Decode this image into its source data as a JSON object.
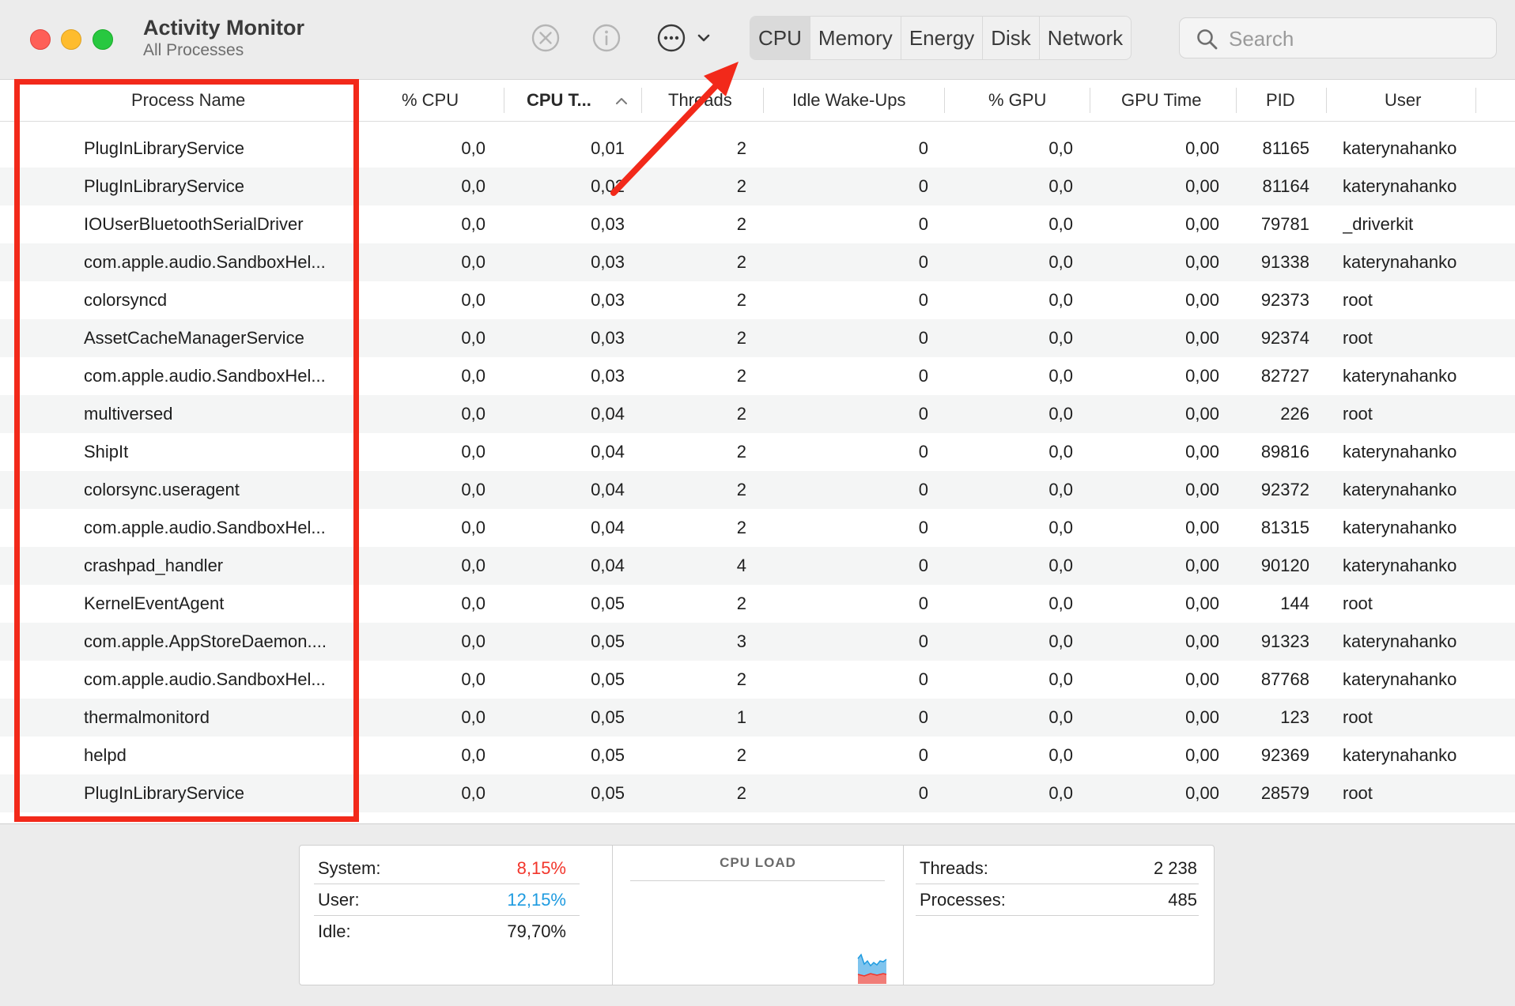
{
  "window": {
    "title": "Activity Monitor",
    "subtitle": "All Processes"
  },
  "toolbar": {
    "icons": [
      "stop-process-icon",
      "info-icon",
      "more-options-icon",
      "chevron-down-icon"
    ],
    "tabs": [
      {
        "label": "CPU",
        "active": true
      },
      {
        "label": "Memory",
        "active": false
      },
      {
        "label": "Energy",
        "active": false
      },
      {
        "label": "Disk",
        "active": false
      },
      {
        "label": "Network",
        "active": false
      }
    ],
    "search": {
      "placeholder": "Search",
      "value": ""
    }
  },
  "table": {
    "columns": [
      {
        "label": "Process Name"
      },
      {
        "label": "% CPU"
      },
      {
        "label": "CPU T...",
        "sorted": true,
        "sort_direction": "ascending"
      },
      {
        "label": "Threads"
      },
      {
        "label": "Idle Wake-Ups"
      },
      {
        "label": "% GPU"
      },
      {
        "label": "GPU Time"
      },
      {
        "label": "PID"
      },
      {
        "label": "User"
      }
    ],
    "rows": [
      [
        "PlugInLibraryService",
        "0,0",
        "0,01",
        "2",
        "0",
        "0,0",
        "0,00",
        "81165",
        "katerynahanko"
      ],
      [
        "PlugInLibraryService",
        "0,0",
        "0,02",
        "2",
        "0",
        "0,0",
        "0,00",
        "81164",
        "katerynahanko"
      ],
      [
        "IOUserBluetoothSerialDriver",
        "0,0",
        "0,03",
        "2",
        "0",
        "0,0",
        "0,00",
        "79781",
        "_driverkit"
      ],
      [
        "com.apple.audio.SandboxHel...",
        "0,0",
        "0,03",
        "2",
        "0",
        "0,0",
        "0,00",
        "91338",
        "katerynahanko"
      ],
      [
        "colorsyncd",
        "0,0",
        "0,03",
        "2",
        "0",
        "0,0",
        "0,00",
        "92373",
        "root"
      ],
      [
        "AssetCacheManagerService",
        "0,0",
        "0,03",
        "2",
        "0",
        "0,0",
        "0,00",
        "92374",
        "root"
      ],
      [
        "com.apple.audio.SandboxHel...",
        "0,0",
        "0,03",
        "2",
        "0",
        "0,0",
        "0,00",
        "82727",
        "katerynahanko"
      ],
      [
        "multiversed",
        "0,0",
        "0,04",
        "2",
        "0",
        "0,0",
        "0,00",
        "226",
        "root"
      ],
      [
        "ShipIt",
        "0,0",
        "0,04",
        "2",
        "0",
        "0,0",
        "0,00",
        "89816",
        "katerynahanko"
      ],
      [
        "colorsync.useragent",
        "0,0",
        "0,04",
        "2",
        "0",
        "0,0",
        "0,00",
        "92372",
        "katerynahanko"
      ],
      [
        "com.apple.audio.SandboxHel...",
        "0,0",
        "0,04",
        "2",
        "0",
        "0,0",
        "0,00",
        "81315",
        "katerynahanko"
      ],
      [
        "crashpad_handler",
        "0,0",
        "0,04",
        "4",
        "0",
        "0,0",
        "0,00",
        "90120",
        "katerynahanko"
      ],
      [
        "KernelEventAgent",
        "0,0",
        "0,05",
        "2",
        "0",
        "0,0",
        "0,00",
        "144",
        "root"
      ],
      [
        "com.apple.AppStoreDaemon....",
        "0,0",
        "0,05",
        "3",
        "0",
        "0,0",
        "0,00",
        "91323",
        "katerynahanko"
      ],
      [
        "com.apple.audio.SandboxHel...",
        "0,0",
        "0,05",
        "2",
        "0",
        "0,0",
        "0,00",
        "87768",
        "katerynahanko"
      ],
      [
        "thermalmonitord",
        "0,0",
        "0,05",
        "1",
        "0",
        "0,0",
        "0,00",
        "123",
        "root"
      ],
      [
        "helpd",
        "0,0",
        "0,05",
        "2",
        "0",
        "0,0",
        "0,00",
        "92369",
        "katerynahanko"
      ],
      [
        "PlugInLibraryService",
        "0,0",
        "0,05",
        "2",
        "0",
        "0,0",
        "0,00",
        "28579",
        "root"
      ]
    ]
  },
  "stats": {
    "system": {
      "label": "System:",
      "value": "8,15%",
      "color": "#f2352b"
    },
    "user": {
      "label": "User:",
      "value": "12,15%",
      "color": "#1e9be0"
    },
    "idle": {
      "label": "Idle:",
      "value": "79,70%"
    },
    "cpu_load_title": "CPU LOAD",
    "threads": {
      "label": "Threads:",
      "value": "2 238"
    },
    "processes": {
      "label": "Processes:",
      "value": "485"
    }
  },
  "annotations": {
    "highlight_color": "#f2291a"
  }
}
